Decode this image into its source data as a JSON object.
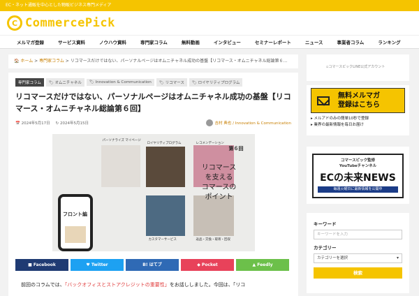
{
  "topbar": {
    "text": "EC・ネット通販を中心とした物販ビジネス専門メディア"
  },
  "brand": {
    "logo_letter": "C",
    "name": "CommercePick",
    "color": "#f5c400"
  },
  "nav": {
    "items": [
      "メルマガ登録",
      "サービス資料",
      "ノウハウ資料",
      "専門家コラム",
      "無料動画",
      "インタビュー",
      "セミナーレポート",
      "ニュース",
      "事業者コラム",
      "ランキング"
    ]
  },
  "breadcrumb": {
    "home": "ホーム",
    "sep": " > ",
    "category": "専門家コラム",
    "current": "リコマースだけではない、パーソナルページはオムニチャネル成功の基盤【リコマース・オムニチャネル総論第６..."
  },
  "article": {
    "category": "専門家コラム",
    "tags": [
      "オムニチャネル",
      "Innovation & Communication",
      "リコマース",
      "ロイヤリティプログラム"
    ],
    "title": "リコマースだけではない、パーソナルページはオムニチャネル成功の基盤【リコマース・オムニチャネル総論第６回】",
    "published": "2024年5月17日",
    "updated": "2024年5月15日",
    "author": "吉村 典也 / Innovation & Communication",
    "hero": {
      "labels": [
        "パーソナライズ\nマイページ",
        "ロイヤリティプログラム",
        "レコメンデーション",
        "カスタマーサービス",
        "返品・交換・取寄・回収"
      ],
      "phone_label": "フロント編",
      "round": "第６回",
      "copy": [
        "リコマース",
        "を支える",
        "コマースの",
        "ポイント"
      ]
    },
    "share": [
      {
        "label": "Facebook",
        "color": "#1f3b73"
      },
      {
        "label": "Twitter",
        "color": "#1da1f2"
      },
      {
        "label": "B! はてブ",
        "color": "#2f6ab5"
      },
      {
        "label": "Pocket",
        "color": "#e8425a"
      },
      {
        "label": "Feedly",
        "color": "#6cc04a"
      }
    ],
    "body_pre": "前回のコラムでは、",
    "body_link": "「バックオフィスとストアクレジットの重要性」",
    "body_post": "をお話ししました。今回は、「リコ"
  },
  "sidebar": {
    "ad_top": "コマースピックLINE公式アカウント",
    "mail": {
      "title_1": "無料メルマガ",
      "title_2": "登録はこちら",
      "points": [
        "メルアドのみの簡単10秒で登録",
        "業界の最新情報を毎日お届け"
      ]
    },
    "youtube": {
      "line1": "コマースピック監修",
      "line2": "YouTubeチャンネル",
      "name": "ECの未来NEWS",
      "schedule": "毎週火曜日に最新情報を公開中"
    },
    "search": {
      "keyword_label": "キーワード",
      "keyword_placeholder": "キーワードを入力",
      "category_label": "カテゴリー",
      "category_value": "カテゴリーを選択",
      "button": "検索"
    }
  }
}
